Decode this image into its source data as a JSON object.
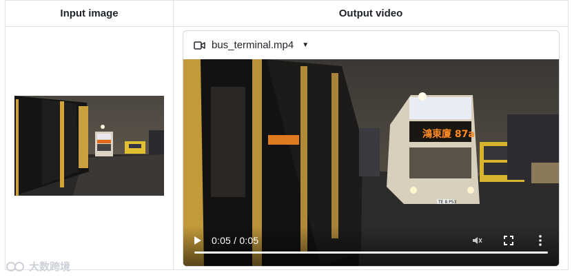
{
  "table": {
    "headers": [
      "Input image",
      "Output video"
    ]
  },
  "video": {
    "file_name": "bus_terminal.mp4",
    "time_display": "0:05 / 0:05",
    "progress": 1.0
  },
  "bus_sign": "鴻東廈 87a",
  "plate": "TE 8 P53",
  "watermark": "大数跨境"
}
